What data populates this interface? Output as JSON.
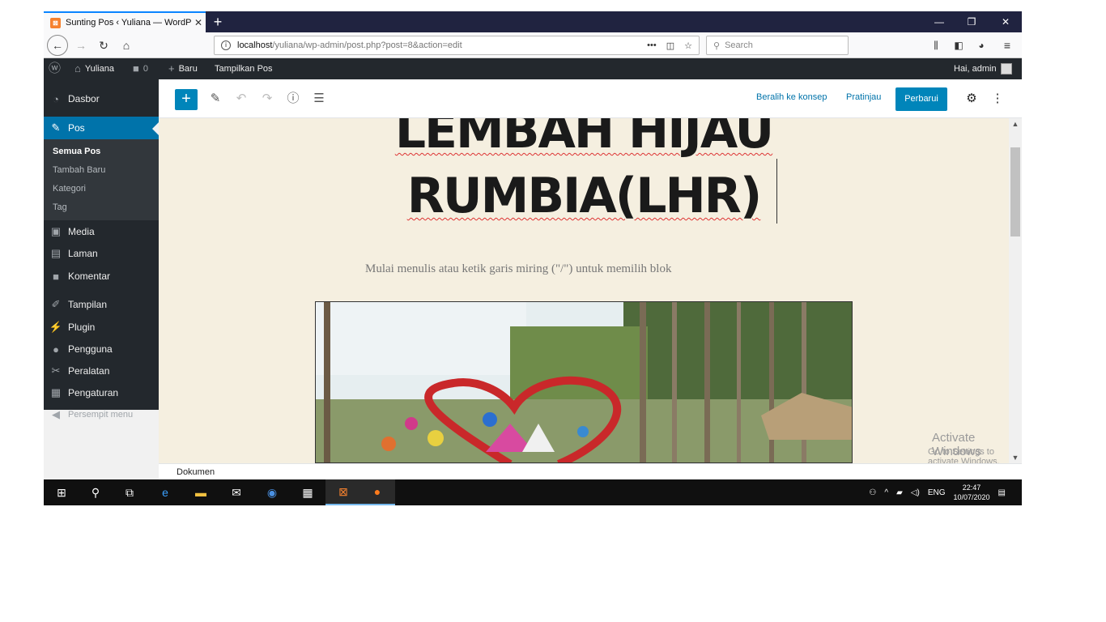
{
  "browser": {
    "tab_title": "Sunting Pos ‹ Yuliana — WordP",
    "tab_favicon": "xampp-icon",
    "url_host": "localhost",
    "url_path": "/yuliana/wp-admin/post.php?post=8&action=edit",
    "url_dots": "•••",
    "search_placeholder": "Search"
  },
  "adminbar": {
    "site_name": "Yuliana",
    "comments_count": "0",
    "new_label": "Baru",
    "view_post_label": "Tampilkan Pos",
    "greeting": "Hai, admin"
  },
  "sidebar": {
    "items": [
      {
        "label": "Dasbor",
        "icon": "dashboard-icon"
      },
      {
        "label": "Pos",
        "icon": "pin-icon"
      },
      {
        "label": "Media",
        "icon": "media-icon"
      },
      {
        "label": "Laman",
        "icon": "pages-icon"
      },
      {
        "label": "Komentar",
        "icon": "comment-icon"
      },
      {
        "label": "Tampilan",
        "icon": "brush-icon"
      },
      {
        "label": "Plugin",
        "icon": "plugin-icon"
      },
      {
        "label": "Pengguna",
        "icon": "user-icon"
      },
      {
        "label": "Peralatan",
        "icon": "wrench-icon"
      },
      {
        "label": "Pengaturan",
        "icon": "settings-icon"
      },
      {
        "label": "Persempit menu",
        "icon": "collapse-icon"
      }
    ],
    "submenu": [
      "Semua Pos",
      "Tambah Baru",
      "Kategori",
      "Tag"
    ]
  },
  "editor": {
    "switch_draft": "Beralih ke konsep",
    "preview": "Pratinjau",
    "update": "Perbarui",
    "title_line1": "LEMBAH HIJAU",
    "title_line2": "RUMBIA(LHR)",
    "placeholder": "Mulai menulis atau ketik garis miring (\"/\") untuk memilih blok",
    "footer": "Dokumen"
  },
  "watermark": {
    "line1": "Activate Windows",
    "line2": "Go to Settings to activate Windows."
  },
  "taskbar": {
    "lang": "ENG",
    "time": "22:47",
    "date": "10/07/2020"
  },
  "colors": {
    "accent": "#0085ba",
    "wp_dark": "#23282d",
    "canvas": "#f5efe0"
  }
}
